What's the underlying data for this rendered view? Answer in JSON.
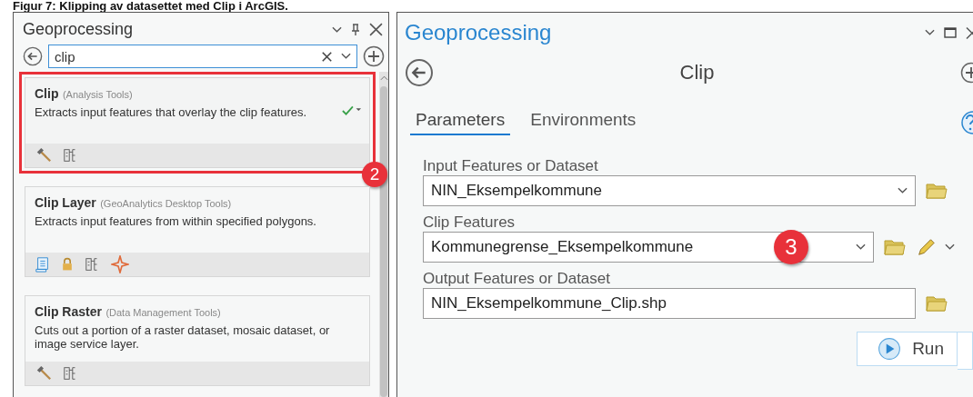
{
  "caption": "Figur 7: Klipping av datasettet med Clip i ArcGIS.",
  "left_panel": {
    "title": "Geoprocessing",
    "search": {
      "value": "clip"
    },
    "results": [
      {
        "name": "Clip",
        "category": "(Analysis Tools)",
        "description": "Extracts input features that overlay the clip features.",
        "selected": true,
        "callout": "2",
        "icons": [
          {
            "kind": "hammer"
          },
          {
            "kind": "model"
          }
        ]
      },
      {
        "name": "Clip Layer",
        "category": "(GeoAnalytics Desktop Tools)",
        "description": "Extracts input features from within specified polygons.",
        "selected": false,
        "icons": [
          {
            "kind": "script"
          },
          {
            "kind": "lock"
          },
          {
            "kind": "model"
          },
          {
            "kind": "star"
          }
        ]
      },
      {
        "name": "Clip Raster",
        "category": "(Data Management Tools)",
        "description": "Cuts out a portion of a raster dataset, mosaic dataset, or image service layer.",
        "selected": false,
        "icons": [
          {
            "kind": "hammer"
          },
          {
            "kind": "model"
          }
        ]
      }
    ]
  },
  "right_panel": {
    "title": "Geoprocessing",
    "tool_title": "Clip",
    "tabs": [
      {
        "label": "Parameters",
        "selected": true
      },
      {
        "label": "Environments",
        "selected": false
      }
    ],
    "params": [
      {
        "label": "Input Features or Dataset",
        "value": "NIN_Eksempelkommune",
        "kind": "dropdown"
      },
      {
        "label": "Clip Features",
        "value": "Kommunegrense_Eksempelkommune",
        "kind": "dropdown-edit",
        "callout": "3"
      },
      {
        "label": "Output Features or Dataset",
        "value": "NIN_Eksempelkommune_Clip.shp",
        "kind": "text"
      }
    ],
    "run_button": "Run"
  }
}
